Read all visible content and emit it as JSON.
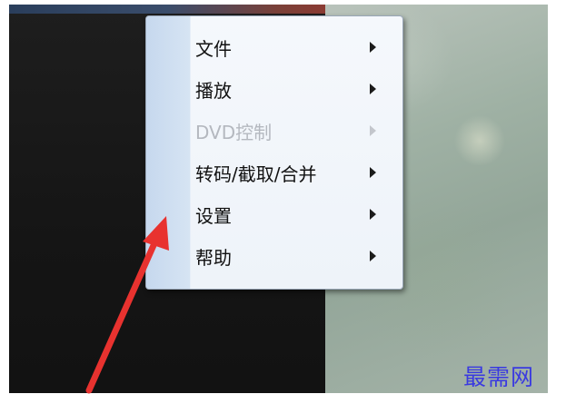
{
  "context_menu": {
    "items": [
      {
        "label": "文件",
        "enabled": true,
        "has_submenu": true
      },
      {
        "label": "播放",
        "enabled": true,
        "has_submenu": true
      },
      {
        "label": "DVD控制",
        "enabled": false,
        "has_submenu": true
      },
      {
        "label": "转码/截取/合并",
        "enabled": true,
        "has_submenu": true
      },
      {
        "label": "设置",
        "enabled": true,
        "has_submenu": true
      },
      {
        "label": "帮助",
        "enabled": true,
        "has_submenu": true
      }
    ]
  },
  "annotation": {
    "arrow_color": "#e8322f"
  },
  "watermark": {
    "text": "最需网",
    "color": "#3a3ae0"
  }
}
